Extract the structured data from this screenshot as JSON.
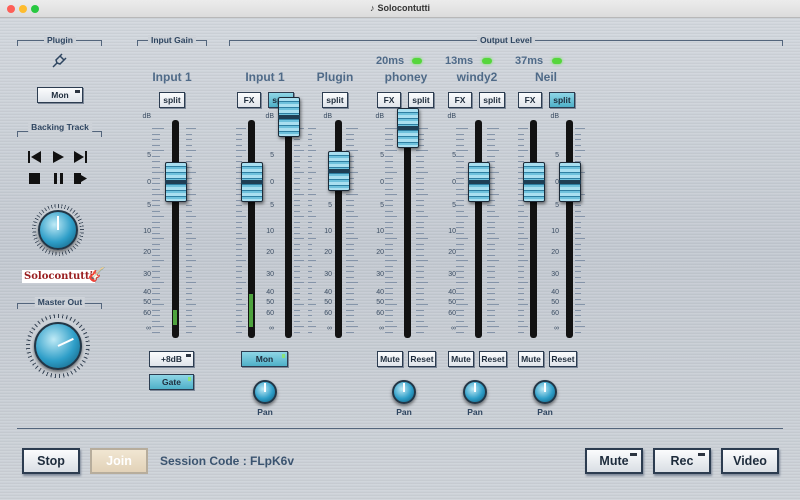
{
  "window": {
    "title": "Solocontutti"
  },
  "groups": {
    "plugin": "Plugin",
    "input_gain": "Input Gain",
    "output_level": "Output Level",
    "backing_track": "Backing Track",
    "master_out": "Master Out"
  },
  "left_panel": {
    "plugin_mon": "Mon",
    "logo_text": "Solocontutti"
  },
  "channels": [
    {
      "name": "Input 1",
      "buttons": [
        "split"
      ],
      "extra": [
        "+8dB",
        "Gate"
      ],
      "fader_db": 0
    },
    {
      "name": "Input 1",
      "buttons": [
        "FX",
        "split"
      ],
      "mon": "Mon",
      "fader_db_left": 0,
      "fader_db_right": 12,
      "pan": "Pan"
    },
    {
      "name": "Plugin",
      "buttons": [
        "split"
      ],
      "fader_db": 2
    },
    {
      "name": "phoney",
      "latency": "20ms",
      "buttons": [
        "FX",
        "split"
      ],
      "mute": "Mute",
      "reset": "Reset",
      "pan": "Pan",
      "fader_db": 10
    },
    {
      "name": "windy2",
      "latency": "13ms",
      "buttons": [
        "FX",
        "split"
      ],
      "mute": "Mute",
      "reset": "Reset",
      "pan": "Pan",
      "fader_db": 0
    },
    {
      "name": "Neil",
      "latency": "37ms",
      "buttons": [
        "FX",
        "split"
      ],
      "mute": "Mute",
      "reset": "Reset",
      "pan": "Pan",
      "fader_db_left": 0,
      "fader_db_right": 0
    }
  ],
  "scale_labels": [
    "dB",
    "5",
    "0",
    "5",
    "10",
    "20",
    "30",
    "40",
    "50",
    "60",
    "∞"
  ],
  "bottom": {
    "stop": "Stop",
    "join": "Join",
    "session_code": "Session Code : FLpK6v",
    "mute": "Mute",
    "rec": "Rec",
    "video": "Video"
  },
  "colors": {
    "accent": "#4fb0c8",
    "meter": "#4ea33e",
    "latency_led": "#55d63c",
    "logo": "#9a1e20"
  }
}
